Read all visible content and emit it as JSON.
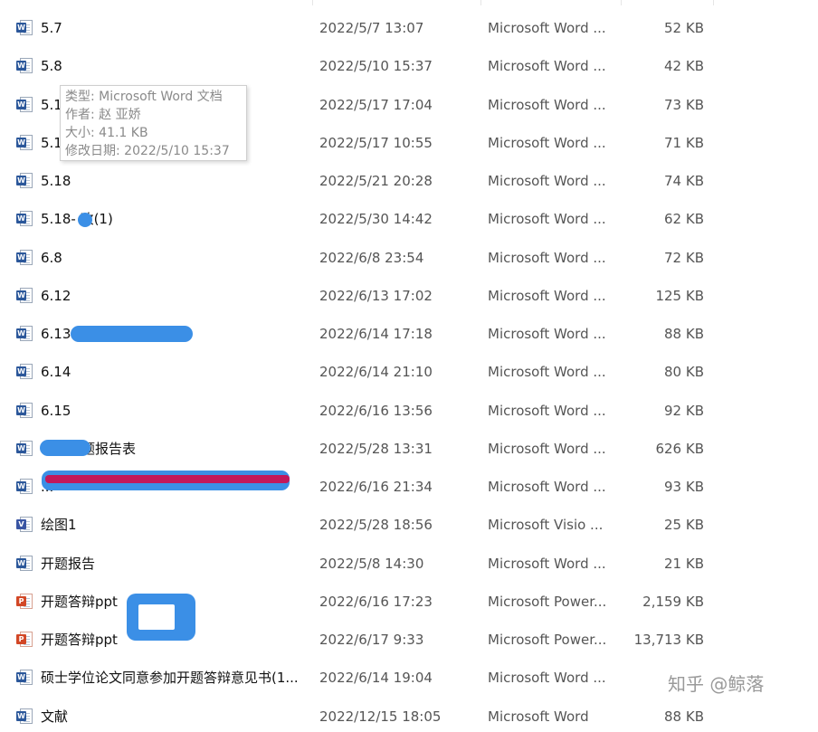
{
  "files": [
    {
      "name": "5.7",
      "date": "2022/5/7 13:07",
      "type": "Microsoft Word ...",
      "size": "52 KB",
      "icon": "word-doc-icon"
    },
    {
      "name": "5.8",
      "date": "2022/5/10 15:37",
      "type": "Microsoft Word ...",
      "size": "42 KB",
      "icon": "word-doc-icon"
    },
    {
      "name": "5.1",
      "date": "2022/5/17 17:04",
      "type": "Microsoft Word ...",
      "size": "73 KB",
      "icon": "word-doc-icon"
    },
    {
      "name": "5.1",
      "date": "2022/5/17 10:55",
      "type": "Microsoft Word ...",
      "size": "71 KB",
      "icon": "word-doc-icon"
    },
    {
      "name": "5.18",
      "date": "2022/5/21 20:28",
      "type": "Microsoft Word ...",
      "size": "74 KB",
      "icon": "word-doc-icon"
    },
    {
      "name": "5.18-   改(1)",
      "date": "2022/5/30 14:42",
      "type": "Microsoft Word ...",
      "size": "62 KB",
      "icon": "word-doc-icon"
    },
    {
      "name": "6.8",
      "date": "2022/6/8 23:54",
      "type": "Microsoft Word ...",
      "size": "72 KB",
      "icon": "word-doc-icon"
    },
    {
      "name": "6.12",
      "date": "2022/6/13 17:02",
      "type": "Microsoft Word ...",
      "size": "125 KB",
      "icon": "word-doc-icon"
    },
    {
      "name": "6.13",
      "date": "2022/6/14 17:18",
      "type": "Microsoft Word ...",
      "size": "88 KB",
      "icon": "word-doc-icon"
    },
    {
      "name": "6.14",
      "date": "2022/6/14 21:10",
      "type": "Microsoft Word ...",
      "size": "80 KB",
      "icon": "word-doc-icon"
    },
    {
      "name": "6.15",
      "date": "2022/6/16 13:56",
      "type": "Microsoft Word ...",
      "size": "92 KB",
      "icon": "word-doc-icon"
    },
    {
      "name": "——开题报告表",
      "date": "2022/5/28 13:31",
      "type": "Microsoft Word ...",
      "size": "626 KB",
      "icon": "word-doc-icon"
    },
    {
      "name": "...",
      "date": "2022/6/16 21:34",
      "type": "Microsoft Word ...",
      "size": "93 KB",
      "icon": "word-doc-icon"
    },
    {
      "name": "绘图1",
      "date": "2022/5/28 18:56",
      "type": "Microsoft Visio ...",
      "size": "25 KB",
      "icon": "visio-doc-icon"
    },
    {
      "name": "开题报告",
      "date": "2022/5/8 14:30",
      "type": "Microsoft Word ...",
      "size": "21 KB",
      "icon": "word-doc-icon"
    },
    {
      "name": "开题答辩ppt",
      "date": "2022/6/16 17:23",
      "type": "Microsoft Power...",
      "size": "2,159 KB",
      "icon": "powerpoint-doc-icon"
    },
    {
      "name": "开题答辩ppt",
      "date": "2022/6/17 9:33",
      "type": "Microsoft Power...",
      "size": "13,713 KB",
      "icon": "powerpoint-doc-icon"
    },
    {
      "name": "硕士学位论文同意参加开题答辩意见书(1...",
      "date": "2022/6/14 19:04",
      "type": "Microsoft Word ...",
      "size": "",
      "icon": "word-doc-icon"
    },
    {
      "name": "文献",
      "date": "2022/12/15 18:05",
      "type": "Microsoft Word",
      "size": "88 KB",
      "icon": "word-doc-icon"
    }
  ],
  "tooltip": {
    "type_line": "类型: Microsoft Word 文档",
    "author_line": "作者: 赵 亚娇",
    "size_line": "大小: 41.1 KB",
    "modified_line": "修改日期: 2022/5/10 15:37"
  },
  "watermark": {
    "text": "知乎 @鲸落"
  },
  "colors": {
    "word": "#2b579a",
    "visio": "#3955a3",
    "powerpoint": "#d24726",
    "redaction_blue": "#3b8fe6",
    "redaction_pink": "#c2185b"
  }
}
